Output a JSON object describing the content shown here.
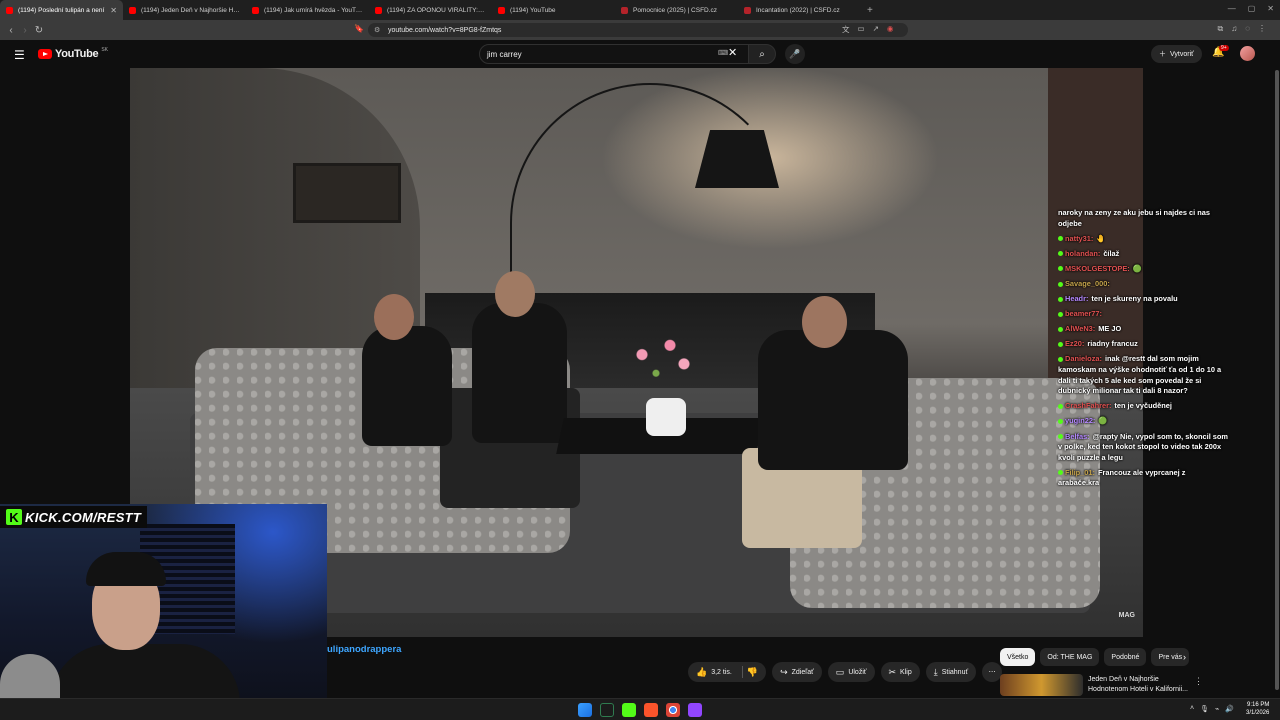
{
  "browser": {
    "tabs": [
      {
        "title": "(1194) Poslední tulipán a není",
        "active": true,
        "favicon": "youtube"
      },
      {
        "title": "(1194) Jeden Deň v Najhoršie Hodnot",
        "favicon": "youtube"
      },
      {
        "title": "(1194) Jak umírá hvězda - YouTube",
        "favicon": "youtube"
      },
      {
        "title": "(1194) ZA OPONOU VIRALITY: MEJŠ",
        "favicon": "youtube"
      },
      {
        "title": "(1194) YouTube",
        "favicon": "youtube"
      },
      {
        "title": "Pomocnice (2025) | ČSFD.cz",
        "favicon": "csfd"
      },
      {
        "title": "Incantation (2022) | ČSFD.cz",
        "favicon": "csfd"
      }
    ],
    "url": "youtube.com/watch?v=8PG8-fZmtqs"
  },
  "youtube": {
    "logo_text": "YouTube",
    "logo_country": "SK",
    "search_value": "jim carrey",
    "create_label": "Vytvoriť",
    "notifications_badge": "9+",
    "channel_fragment": "ulipanodrappera",
    "actions": {
      "like_count": "3,2 tis.",
      "share": "Zdieľať",
      "save": "Uložiť",
      "clip": "Klip",
      "download": "Stiahnuť"
    },
    "chips": [
      "Všetko",
      "Od: THE MAG",
      "Podobné",
      "Pre vás"
    ],
    "recommendation": {
      "title": "Jeden Deň v Najhoršie Hodnotenom Hoteli v Kalifornii..."
    },
    "video_watermark": "MAG"
  },
  "overlay": {
    "kick_text": "KICK.COM/RESTT",
    "chat": [
      {
        "user": "",
        "color": "#ffffff",
        "text": "naroky na zeny ze aku jebu si najdes ci nas odjebe"
      },
      {
        "user": "natty31:",
        "color": "#e05050",
        "text": "🤚"
      },
      {
        "user": "holandan:",
        "color": "#e05050",
        "text": "čílaž"
      },
      {
        "user": "MSKOLGESTOPE:",
        "color": "#e05050",
        "text": "🟢"
      },
      {
        "user": "Savage_000:",
        "color": "#c4a24a",
        "text": ""
      },
      {
        "user": "Headr:",
        "color": "#b487ff",
        "text": "ten je skureny na povalu"
      },
      {
        "user": "beamer77:",
        "color": "#e05050",
        "text": ""
      },
      {
        "user": "AlWeN3:",
        "color": "#e05050",
        "text": "ME JO"
      },
      {
        "user": "Ez20:",
        "color": "#e05050",
        "text": "riadny francuz"
      },
      {
        "user": "Danieloza:",
        "color": "#e05050",
        "text": "inak @restt dal som mojim kamoskam na výške ohodnotiť ťa od 1 do 10 a dali ti takých 5 ale ked som povedal že si dubnický milionar tak ti dali 8 nazor?"
      },
      {
        "user": "CrashFahrer:",
        "color": "#e05050",
        "text": "ten je vyčuděnej"
      },
      {
        "user": "yugin22:",
        "color": "#b487ff",
        "text": "🟢"
      },
      {
        "user": "Belfas:",
        "color": "#b487ff",
        "text": "@rapty Nie, vypol som to, skoncil som v polke, ked ten kokot stopol to video tak 200x kvoli puzzle a legu"
      },
      {
        "user": "Filip_01:",
        "color": "#c4a24a",
        "text": "Francouz ale vyprcanej z arabače.kra"
      }
    ]
  },
  "taskbar": {
    "time": "9:16 PM",
    "date": "3/1/2026"
  }
}
